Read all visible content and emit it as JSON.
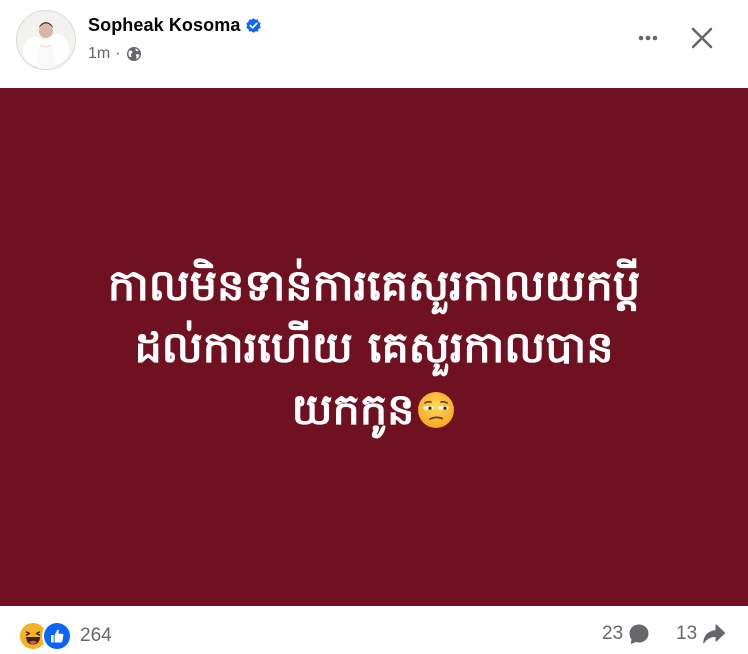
{
  "post": {
    "author": {
      "name": "Sopheak Kosoma",
      "verified": true,
      "avatar_icon": "profile-photo"
    },
    "timestamp": "1m",
    "separator": "·",
    "audience_icon": "globe-icon",
    "menu_icon": "more-horizontal-icon",
    "close_icon": "close-icon",
    "background_color": "#701122",
    "text_lines": [
      "កាលមិនទាន់ការគេសួរកាលយកប្តី",
      "ដល់ការហើយ គេសួរកាលបាន",
      "យកកូន"
    ],
    "text_emoji": "unamused-face-emoji"
  },
  "footer": {
    "reaction_icons": [
      "haha-icon",
      "like-icon"
    ],
    "reaction_count": "264",
    "comment_count": "23",
    "comment_icon": "comment-bubble-icon",
    "share_count": "13",
    "share_icon": "share-arrow-icon"
  },
  "colors": {
    "accent_blue": "#0866ff",
    "secondary_text": "#65676b",
    "primary_text": "#050505"
  }
}
